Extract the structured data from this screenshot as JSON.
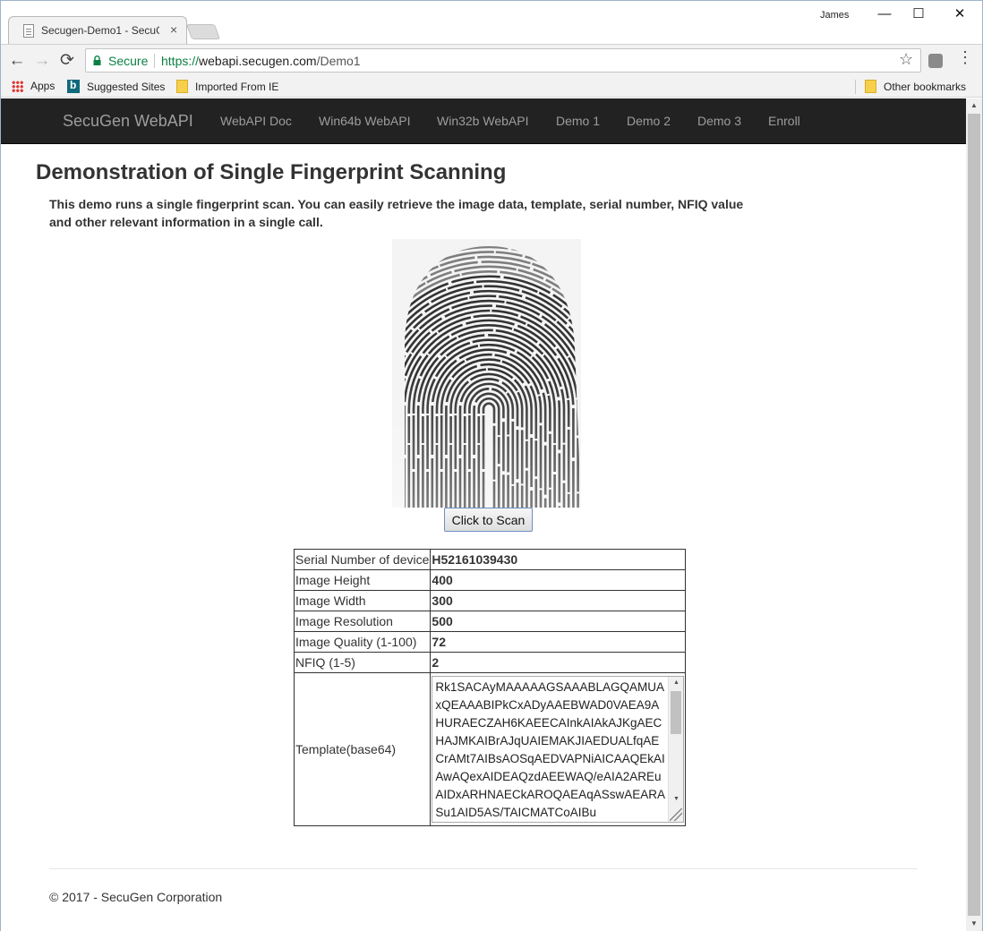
{
  "browser": {
    "tab_title": "Secugen-Demo1 - SecuGen",
    "tab_close": "×",
    "profile_name": "James",
    "window_controls": {
      "minimize": "—",
      "maximize": "☐",
      "close": "✕"
    },
    "secure_label": "Secure",
    "url_protocol": "https://",
    "url_host": "webapi.secugen.com",
    "url_path": "/Demo1",
    "bookmarks": {
      "apps": "Apps",
      "suggested_sites": "Suggested Sites",
      "imported_from_ie": "Imported From IE",
      "other_bookmarks": "Other bookmarks"
    }
  },
  "navbar": {
    "brand": "SecuGen WebAPI",
    "links": [
      "WebAPI Doc",
      "Win64b WebAPI",
      "Win32b WebAPI",
      "Demo 1",
      "Demo 2",
      "Demo 3",
      "Enroll"
    ]
  },
  "page": {
    "title": "Demonstration of Single Fingerprint Scanning",
    "intro": "This demo runs a single fingerprint scan. You can easily retrieve the image data, template, serial number, NFIQ value and other relevant information in a single call.",
    "scan_button": "Click to Scan"
  },
  "results": {
    "serial_label": "Serial Number of device",
    "serial_value": "H52161039430",
    "height_label": "Image Height",
    "height_value": "400",
    "width_label": "Image Width",
    "width_value": "300",
    "resolution_label": "Image Resolution",
    "resolution_value": "500",
    "quality_label": "Image Quality (1-100)",
    "quality_value": "72",
    "nfiq_label": "NFIQ (1-5)",
    "nfiq_value": "2",
    "template_label": "Template(base64)",
    "template_value": "Rk1SACAyMAAAAAGSAAABLAGQAMUAxQEAAABIPkCxADyAAEBWAD0VAEA9AHURAECZAH6KAEECAInkAIAkAJKgAECHAJMKAIBrAJqUAIEMAKJIAEDUALfqAECrAMt7AIBsAOSqAEDVAPNiAICAAQEkAIAwAQexAIDEAQzdAEEWAQ/eAIA2AREuAIDxARHNAECkAROQAEAqASswAEARASu1AID5AS/TAICMATCoAIBu"
  },
  "footer": {
    "copyright": "© 2017 - SecuGen Corporation"
  },
  "icons": {
    "back": "←",
    "forward": "→",
    "reload": "⟳",
    "star": "☆",
    "menu": "⋮"
  },
  "colors": {
    "navbar_bg": "#222222",
    "navbar_text": "#9d9d9d",
    "secure_green": "#0b8043",
    "button_border": "#6d8fc1"
  }
}
